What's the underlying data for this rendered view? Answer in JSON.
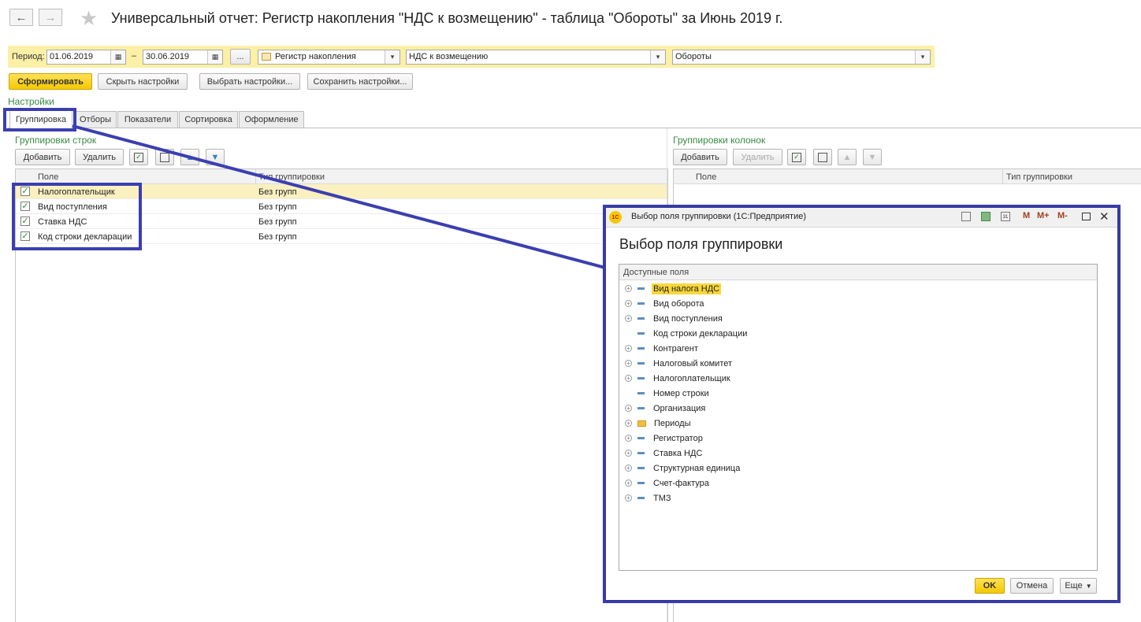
{
  "window": {
    "title": "Универсальный отчет: Регистр накопления \"НДС к возмещению\" - таблица \"Обороты\" за Июнь 2019 г.",
    "back_icon": "arrow-left-icon",
    "forward_icon": "arrow-right-icon",
    "favorite_icon": "star-icon"
  },
  "period_bar": {
    "label": "Период:",
    "date_from": "01.06.2019",
    "separator": "–",
    "date_to": "30.06.2019",
    "more_label": "...",
    "source_type": "Регистр накопления",
    "register": "НДС к возмещению",
    "table": "Обороты"
  },
  "toolbar": {
    "generate": "Сформировать",
    "hide_settings": "Скрыть настройки",
    "choose_settings": "Выбрать настройки...",
    "save_settings": "Сохранить настройки..."
  },
  "settings": {
    "label": "Настройки",
    "tabs": [
      "Группировка",
      "Отборы",
      "Показатели",
      "Сортировка",
      "Оформление"
    ]
  },
  "row_groupings": {
    "title": "Группировки строк",
    "add": "Добавить",
    "delete": "Удалить",
    "columns": [
      "Поле",
      "Тип группировки"
    ],
    "rows": [
      {
        "field": "Налогоплательщик",
        "type": "Без групп"
      },
      {
        "field": "Вид поступления",
        "type": "Без групп"
      },
      {
        "field": "Ставка НДС",
        "type": "Без групп"
      },
      {
        "field": "Код строки декларации",
        "type": "Без групп"
      }
    ]
  },
  "column_groupings": {
    "title": "Группировки колонок",
    "add": "Добавить",
    "delete": "Удалить",
    "columns": [
      "Поле",
      "Тип группировки"
    ]
  },
  "dialog": {
    "window_title": "Выбор поля группировки  (1С:Предприятие)",
    "heading": "Выбор поля группировки",
    "tree_header": "Доступные поля",
    "toolbar_labels": {
      "m": "M",
      "m_plus": "M+",
      "m_minus": "M-"
    },
    "items": [
      {
        "label": "Вид налога НДС",
        "expandable": true,
        "icon": "field",
        "selected": true
      },
      {
        "label": "Вид оборота",
        "expandable": true,
        "icon": "field"
      },
      {
        "label": "Вид поступления",
        "expandable": true,
        "icon": "field"
      },
      {
        "label": "Код строки декларации",
        "expandable": false,
        "icon": "field"
      },
      {
        "label": "Контрагент",
        "expandable": true,
        "icon": "field"
      },
      {
        "label": "Налоговый комитет",
        "expandable": true,
        "icon": "field"
      },
      {
        "label": "Налогоплательщик",
        "expandable": true,
        "icon": "field"
      },
      {
        "label": "Номер строки",
        "expandable": false,
        "icon": "field"
      },
      {
        "label": "Организация",
        "expandable": true,
        "icon": "field"
      },
      {
        "label": "Периоды",
        "expandable": true,
        "icon": "folder"
      },
      {
        "label": "Регистратор",
        "expandable": true,
        "icon": "field"
      },
      {
        "label": "Ставка НДС",
        "expandable": true,
        "icon": "field"
      },
      {
        "label": "Структурная единица",
        "expandable": true,
        "icon": "field"
      },
      {
        "label": "Счет-фактура",
        "expandable": true,
        "icon": "field"
      },
      {
        "label": "ТМЗ",
        "expandable": true,
        "icon": "field"
      }
    ],
    "ok": "OK",
    "cancel": "Отмена",
    "more": "Еще"
  },
  "colors": {
    "highlight_frame": "#3b3fb0",
    "accent_yellow": "#f5c800",
    "section_green": "#3a8a44",
    "period_bar": "#fbf0a6"
  }
}
